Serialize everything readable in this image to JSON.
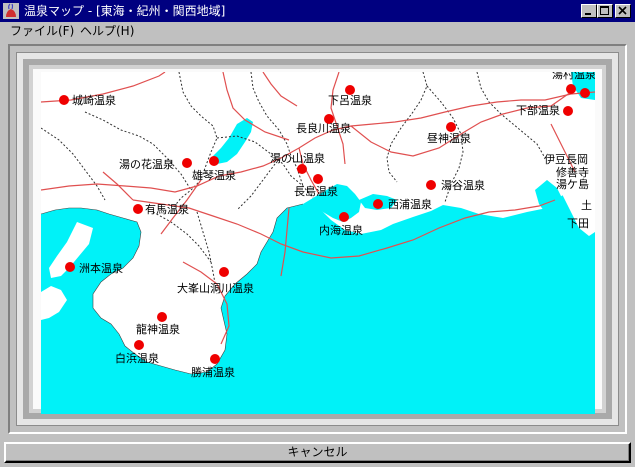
{
  "window": {
    "title": "温泉マップ - [東海・紀州・関西地域]"
  },
  "menu": {
    "file": "ファイル(F)",
    "help": "ヘルプ(H)"
  },
  "onsen": [
    {
      "id": "kinosaki",
      "label": "城崎温泉"
    },
    {
      "id": "gero",
      "label": "下呂温泉"
    },
    {
      "id": "nagaragawa",
      "label": "長良川温泉"
    },
    {
      "id": "hirugami",
      "label": "昼神温泉"
    },
    {
      "id": "yunohana",
      "label": "湯の花温泉"
    },
    {
      "id": "ogoto",
      "label": "雄琴温泉"
    },
    {
      "id": "yunoyama",
      "label": "湯の山温泉"
    },
    {
      "id": "nagashima",
      "label": "長島温泉"
    },
    {
      "id": "yuya",
      "label": "湯谷温泉"
    },
    {
      "id": "arima",
      "label": "有馬温泉"
    },
    {
      "id": "nishiura",
      "label": "西浦温泉"
    },
    {
      "id": "utsumi",
      "label": "内海温泉"
    },
    {
      "id": "sumoto",
      "label": "洲本温泉"
    },
    {
      "id": "omine",
      "label": "大峯山洞川温泉"
    },
    {
      "id": "ryujin",
      "label": "龍神温泉"
    },
    {
      "id": "shirahama",
      "label": "白浜温泉"
    },
    {
      "id": "katsuura",
      "label": "勝浦温泉"
    },
    {
      "id": "shimobe",
      "label": "下部温泉"
    },
    {
      "id": "yugashima",
      "label": "湯ケ島"
    },
    {
      "id": "shuzenji",
      "label": "修善寺"
    },
    {
      "id": "izunagaoka",
      "label": "伊豆長岡"
    },
    {
      "id": "yumura",
      "label": "湯村温泉"
    },
    {
      "id": "shimoda",
      "label": "下田"
    },
    {
      "id": "toi",
      "label": "土"
    }
  ],
  "footer": {
    "cancel_label": "キャンセル"
  },
  "colors": {
    "sea": "#00f2f8",
    "land": "#ffffff",
    "marker": "#ef0000",
    "titlebar": "#000080"
  }
}
